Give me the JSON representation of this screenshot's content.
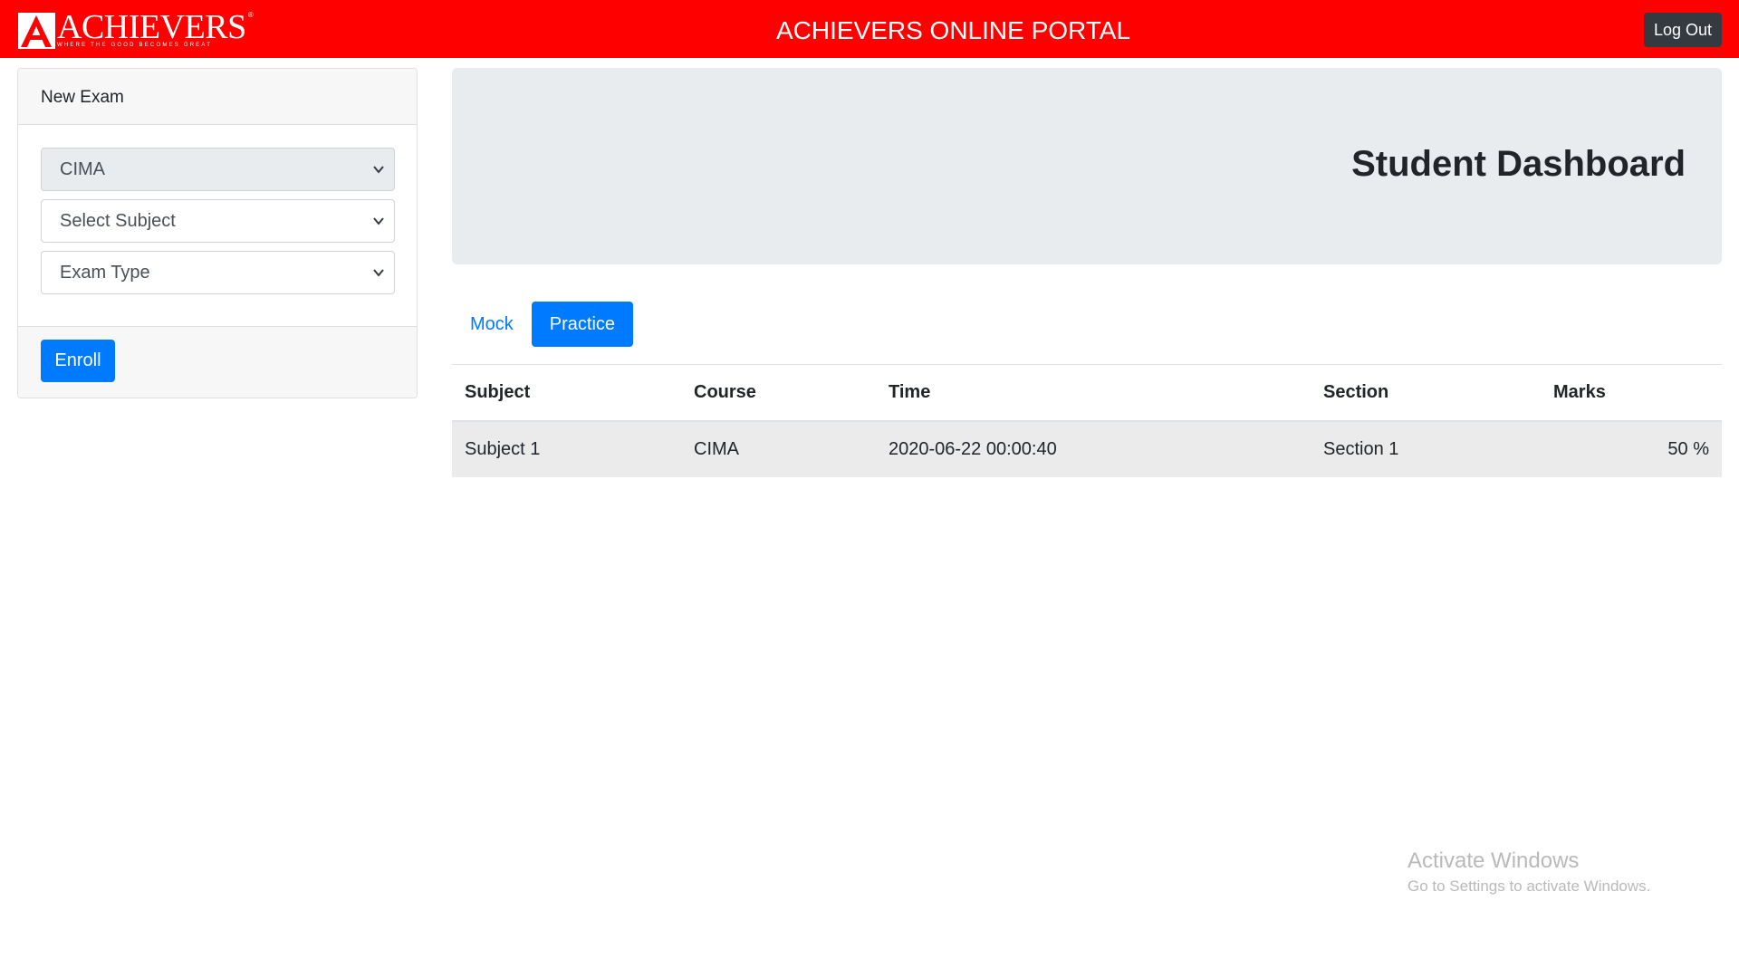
{
  "header": {
    "brand_name": "ACHIEVERS",
    "brand_tagline": "WHERE THE GOOD BECOMES GREAT",
    "brand_reg": "®",
    "portal_title": "ACHIEVERS ONLINE PORTAL",
    "logout_label": "Log Out",
    "bg_color": "#ff0000"
  },
  "sidebar": {
    "card_title": "New Exam",
    "course_select": {
      "value": "CIMA",
      "disabled": true
    },
    "subject_select": {
      "value": "Select Subject"
    },
    "exam_type_select": {
      "value": "Exam Type"
    },
    "enroll_label": "Enroll"
  },
  "dashboard": {
    "title": "Student Dashboard"
  },
  "tabs": [
    {
      "label": "Mock",
      "active": false
    },
    {
      "label": "Practice",
      "active": true
    }
  ],
  "table": {
    "columns": [
      "Subject",
      "Course",
      "Time",
      "Section",
      "Marks"
    ],
    "rows": [
      {
        "subject": "Subject 1",
        "course": "CIMA",
        "time": "2020-06-22 00:00:40",
        "section": "Section 1",
        "marks": "50 %"
      }
    ]
  },
  "watermark": {
    "title": "Activate Windows",
    "subtitle": "Go to Settings to activate Windows."
  },
  "colors": {
    "primary": "#007bff",
    "dark": "#343a40",
    "brand_red": "#ff0000"
  }
}
